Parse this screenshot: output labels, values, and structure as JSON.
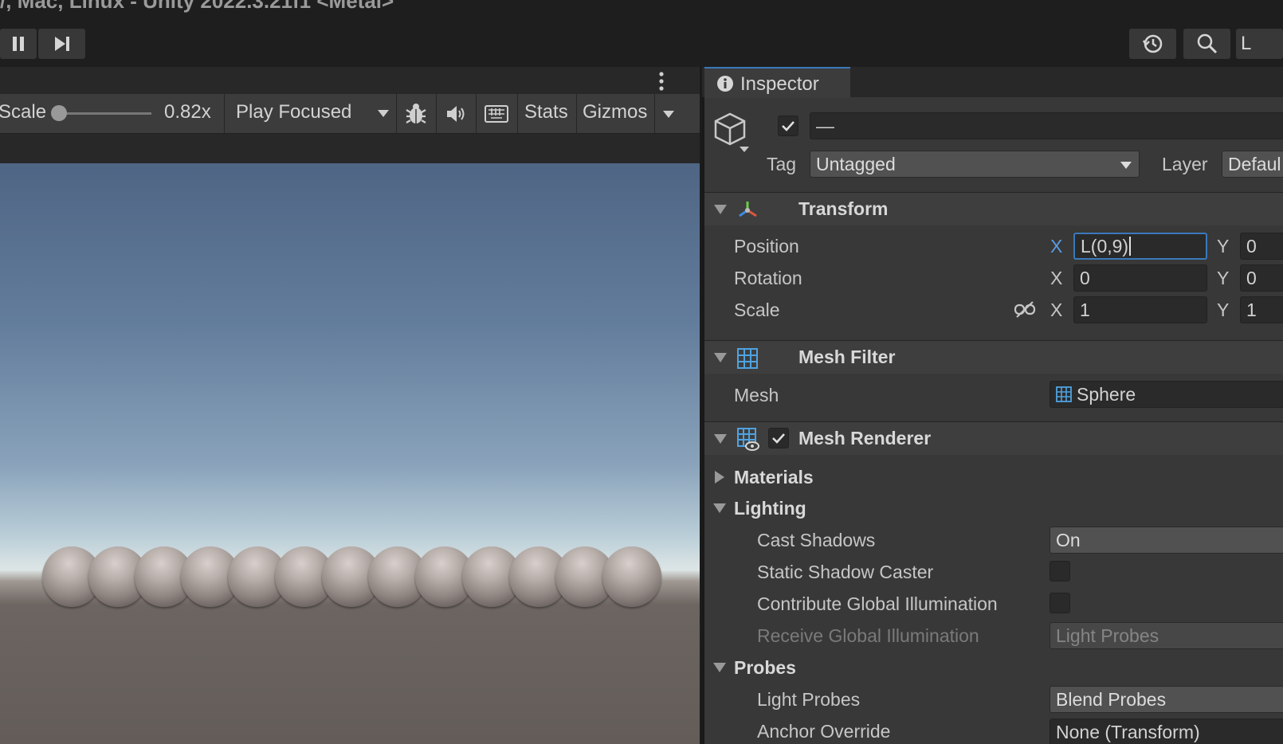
{
  "window": {
    "title": "/, Mac, Linux - Unity 2022.3.21f1 <Metal>"
  },
  "toolbar": {
    "right_letter": "L"
  },
  "game_view": {
    "scale_label": "Scale",
    "scale_value": "0.82x",
    "scale_fraction": 0.1,
    "play_mode": "Play Focused",
    "stats_label": "Stats",
    "gizmos_label": "Gizmos",
    "sphere_count": 13,
    "colors": {
      "sky_top": "#4f6584",
      "horizon": "#dde6e6",
      "ground": "#635c58"
    }
  },
  "inspector": {
    "tab_label": "Inspector",
    "object_active": true,
    "object_name": "—",
    "tag_label": "Tag",
    "tag_value": "Untagged",
    "layer_label": "Layer",
    "layer_value": "Defaul",
    "transform": {
      "title": "Transform",
      "position_label": "Position",
      "rotation_label": "Rotation",
      "scale_label": "Scale",
      "x_axis": "X",
      "y_axis": "Y",
      "position_x": "L(0,9)",
      "position_y": "0",
      "rotation_x": "0",
      "rotation_y": "0",
      "scale_x": "1",
      "scale_y": "1"
    },
    "mesh_filter": {
      "title": "Mesh Filter",
      "mesh_label": "Mesh",
      "mesh_value": "Sphere"
    },
    "mesh_renderer": {
      "title": "Mesh Renderer",
      "enabled": true,
      "materials_label": "Materials",
      "lighting_label": "Lighting",
      "cast_shadows_label": "Cast Shadows",
      "cast_shadows_value": "On",
      "static_shadow_label": "Static Shadow Caster",
      "contribute_gi_label": "Contribute Global Illumination",
      "receive_gi_label": "Receive Global Illumination",
      "receive_gi_value": "Light Probes",
      "probes_label": "Probes",
      "light_probes_label": "Light Probes",
      "light_probes_value": "Blend Probes",
      "anchor_override_label": "Anchor Override",
      "anchor_override_value": "None (Transform)"
    },
    "accent_color": "#3a79bb"
  }
}
